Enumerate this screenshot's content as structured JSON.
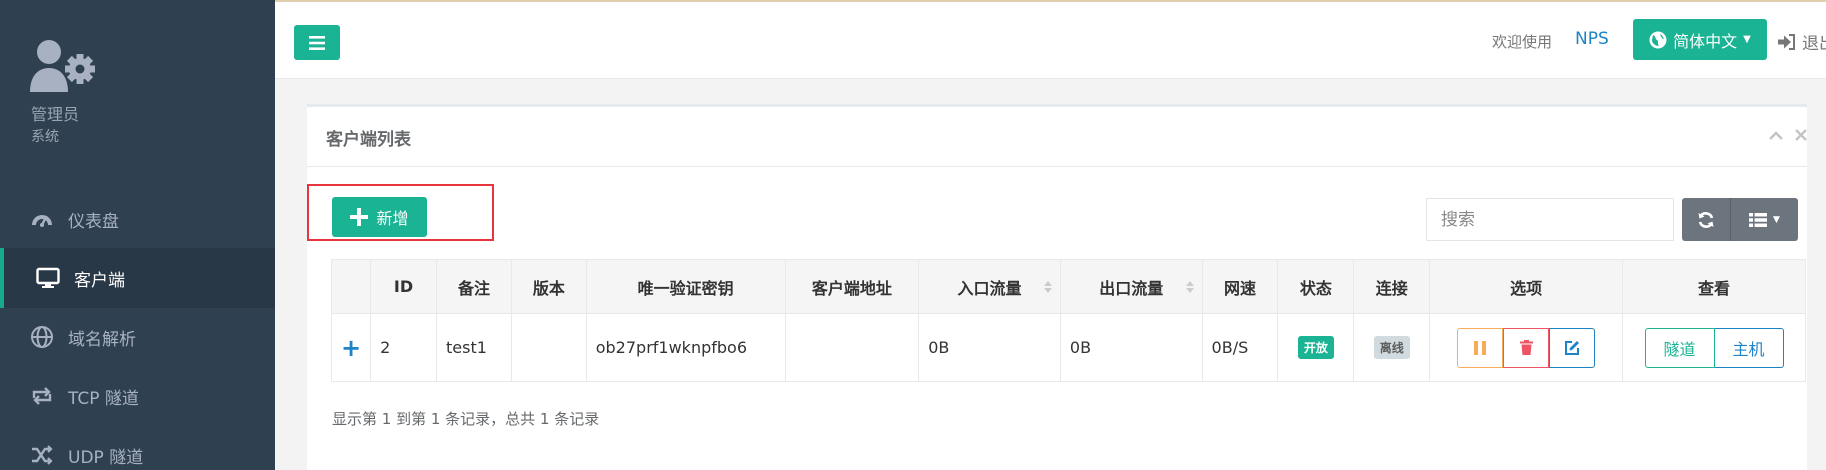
{
  "sidebar": {
    "profile": {
      "name": "管理员",
      "role": "系统"
    },
    "items": [
      {
        "label": "仪表盘",
        "icon": "dashboard-icon"
      },
      {
        "label": "客户端",
        "icon": "desktop-icon"
      },
      {
        "label": "域名解析",
        "icon": "globe-icon"
      },
      {
        "label": "TCP 隧道",
        "icon": "exchange-icon"
      },
      {
        "label": "UDP 隧道",
        "icon": "random-icon"
      }
    ],
    "active_index": 1
  },
  "topbar": {
    "welcome": "欢迎使用",
    "brand": "NPS",
    "language": "简体中文",
    "logout": "退出"
  },
  "panel": {
    "title": "客户端列表",
    "add_label": "新增",
    "search_placeholder": "搜索",
    "columns": [
      "",
      "ID",
      "备注",
      "版本",
      "唯一验证密钥",
      "客户端地址",
      "入口流量",
      "出口流量",
      "网速",
      "状态",
      "连接",
      "选项",
      "查看"
    ],
    "rows": [
      {
        "expand": "+",
        "id": "2",
        "remark": "test1",
        "version": "",
        "vkey": "ob27prf1wknpfbo6",
        "address": "",
        "in_flow": "0B",
        "out_flow": "0B",
        "speed": "0B/S",
        "status": "开放",
        "connection": "离线",
        "view_tunnel": "隧道",
        "view_host": "主机"
      }
    ],
    "pagination": "显示第 1 到第 1 条记录，总共 1 条记录"
  },
  "colors": {
    "sidebar_bg": "#2f4050",
    "primary": "#1ab394",
    "link": "#1c84c6",
    "warning": "#f8ac59",
    "danger": "#ed5565",
    "highlight": "#e8343c"
  }
}
